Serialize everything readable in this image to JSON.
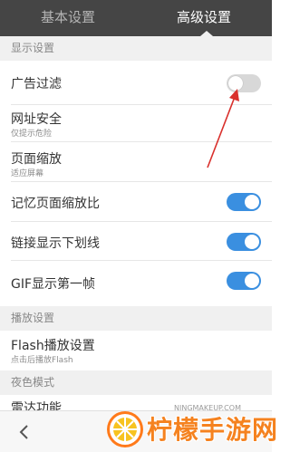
{
  "tabs": {
    "basic": "基本设置",
    "advanced": "高级设置"
  },
  "sections": {
    "display": "显示设置",
    "playback": "播放设置",
    "night": "夜色模式"
  },
  "rows": {
    "ad_filter": {
      "title": "广告过滤",
      "toggle": false
    },
    "url_security": {
      "title": "网址安全",
      "subtitle": "仅提示危险"
    },
    "page_zoom": {
      "title": "页面缩放",
      "subtitle": "适应屏幕"
    },
    "remember_zoom": {
      "title": "记忆页面缩放比",
      "toggle": true
    },
    "link_underline": {
      "title": "链接显示下划线",
      "toggle": true
    },
    "gif_first_frame": {
      "title": "GIF显示第一帧",
      "toggle": true
    },
    "flash_play": {
      "title": "Flash播放设置",
      "subtitle": "点击后播放Flash"
    },
    "radar": {
      "title": "雷达功能"
    }
  },
  "colors": {
    "toggle_on": "#3a8fe0",
    "toggle_off": "#d8d8d8",
    "tabbar": "#454545",
    "annotation_arrow": "#d9302c"
  },
  "watermark": {
    "url": "NINGMAKEUP.COM",
    "text": "柠檬手游网"
  },
  "icons": {
    "back": "chevron-left-icon"
  }
}
